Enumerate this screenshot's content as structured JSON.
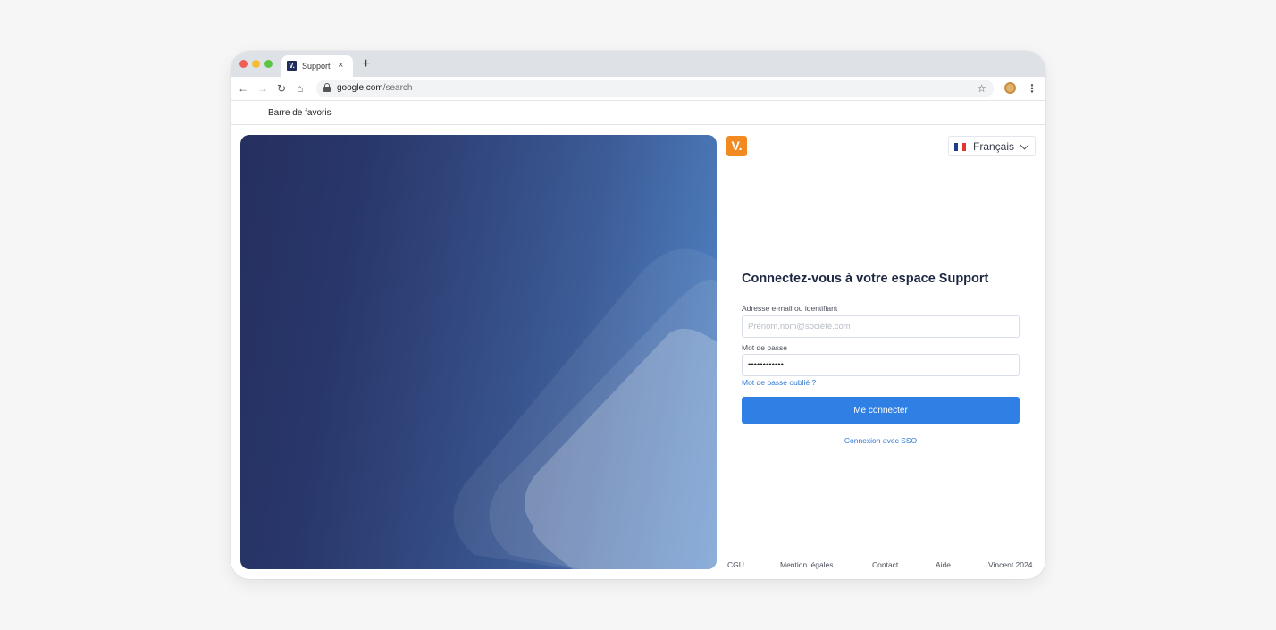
{
  "browser": {
    "tab_title": "Support",
    "tab_favicon": "V.",
    "tab_close": "×",
    "new_tab": "+",
    "url_host": "google.com",
    "url_path": "/search",
    "bookmarks_label": "Barre de favoris"
  },
  "header": {
    "logo_text": "V.",
    "language": "Français",
    "flag_colors": [
      "#1f3c8f",
      "#ffffff",
      "#e3342f"
    ]
  },
  "login": {
    "title": "Connectez-vous à votre espace Support",
    "email_label": "Adresse e-mail ou identifiant",
    "email_placeholder": "Prénom.nom@société.com",
    "password_label": "Mot de passe",
    "password_value": "••••••••••••",
    "forgot_password": "Mot de passe oublié ?",
    "submit_label": "Me connecter",
    "sso_label": "Connexion avec SSO"
  },
  "footer": {
    "links": [
      "CGU",
      "Mention légales",
      "Contact",
      "Aide",
      "Vincent 2024"
    ]
  },
  "colors": {
    "accent": "#2f7fe5",
    "logo": "#f28a22",
    "hero_dark": "#26305f",
    "hero_light": "#5287c9"
  }
}
